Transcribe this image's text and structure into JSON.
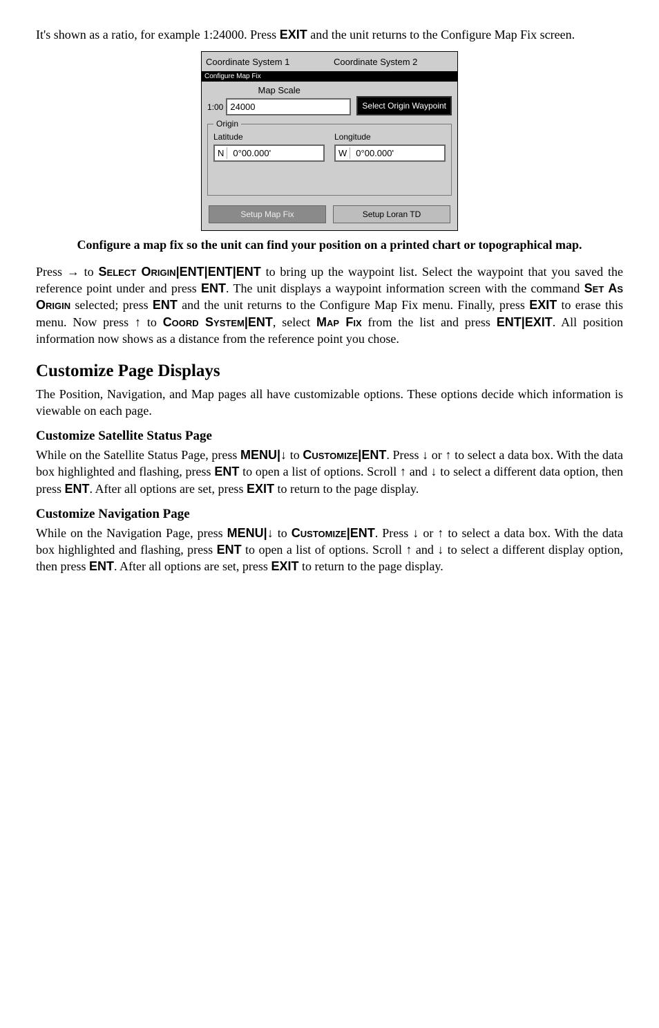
{
  "intro": {
    "p1_a": "It's shown as a ratio, for example 1:24000. Press ",
    "p1_key": "EXIT",
    "p1_b": " and the unit returns to the Configure Map Fix screen."
  },
  "dialog": {
    "coord1": "Coordinate System 1",
    "coord2": "Coordinate System 2",
    "band": "Configure Map Fix",
    "scale_label": "Map Scale",
    "ratio": "1:00",
    "scale_value": "24000",
    "origin_btn": "Select Origin Waypoint",
    "origin_title": "Origin",
    "lat_label": "Latitude",
    "lat_dir": "N",
    "lat_val": "0°00.000'",
    "lon_label": "Longitude",
    "lon_dir": "W",
    "lon_val": "0°00.000'",
    "btn_setup_map": "Setup Map Fix",
    "btn_setup_loran": "Setup Loran TD"
  },
  "caption": "Configure a map fix so the unit can find your position on a printed chart or topographical map.",
  "para2": {
    "a": "Press ",
    "arrow": "→",
    "b": " to ",
    "sc1": "Select Origin",
    "pipe": "|",
    "ent": "ENT",
    "c": " to bring up the waypoint list. Select the waypoint that you saved the reference point under and press ",
    "d": ". The unit displays a waypoint information screen with the command ",
    "sc_set_as_origin": "Set As Origin",
    "e": " selected; press ",
    "f": " and the unit returns to the Configure Map Fix menu. Finally, press ",
    "exit": "EXIT",
    "g": " to erase this menu. Now press ",
    "up": "↑",
    "h": " to ",
    "sc_coord": "Coord System",
    "i": ", select ",
    "sc_mapfix": "Map Fix",
    "j": " from the list and press ",
    "k": ". All position information now shows as a distance from the reference point you chose."
  },
  "h2_custom": "Customize Page Displays",
  "para3": "The Position, Navigation, and Map pages all have customizable options. These options decide which information is viewable on each page.",
  "h3_sat": "Customize Satellite Status Page",
  "sat_para": {
    "a": "While on the Satellite Status Page, press ",
    "menu": "MENU",
    "pipe": "|",
    "down": "↓",
    "b": " to ",
    "sc_custom": "Customize",
    "ent": "ENT",
    "c": ". Press ",
    "d": " or ",
    "up": "↑",
    "e": " to select a data box. With the data box highlighted and flashing, press ",
    "f": " to open a list of options. Scroll ",
    "g": " and ",
    "h": " to select a different data option, then press ",
    "i": ". After all options are set, press ",
    "exit": "EXIT",
    "j": " to return to the page display."
  },
  "h3_nav": "Customize Navigation Page",
  "nav_para": {
    "a": "While on the Navigation Page, press ",
    "menu": "MENU",
    "pipe": "|",
    "down": "↓",
    "b": " to ",
    "sc_custom": "Customize",
    "ent": "ENT",
    "c": ". Press ",
    "d": " or ",
    "up": "↑",
    "e": " to select a data box. With the data box highlighted and flashing, press ",
    "f": " to open a list of options. Scroll ",
    "g": " and ",
    "h": " to select a different display option, then press ",
    "i": ". After all options are set, press ",
    "exit": "EXIT",
    "j": " to return to the page display."
  }
}
